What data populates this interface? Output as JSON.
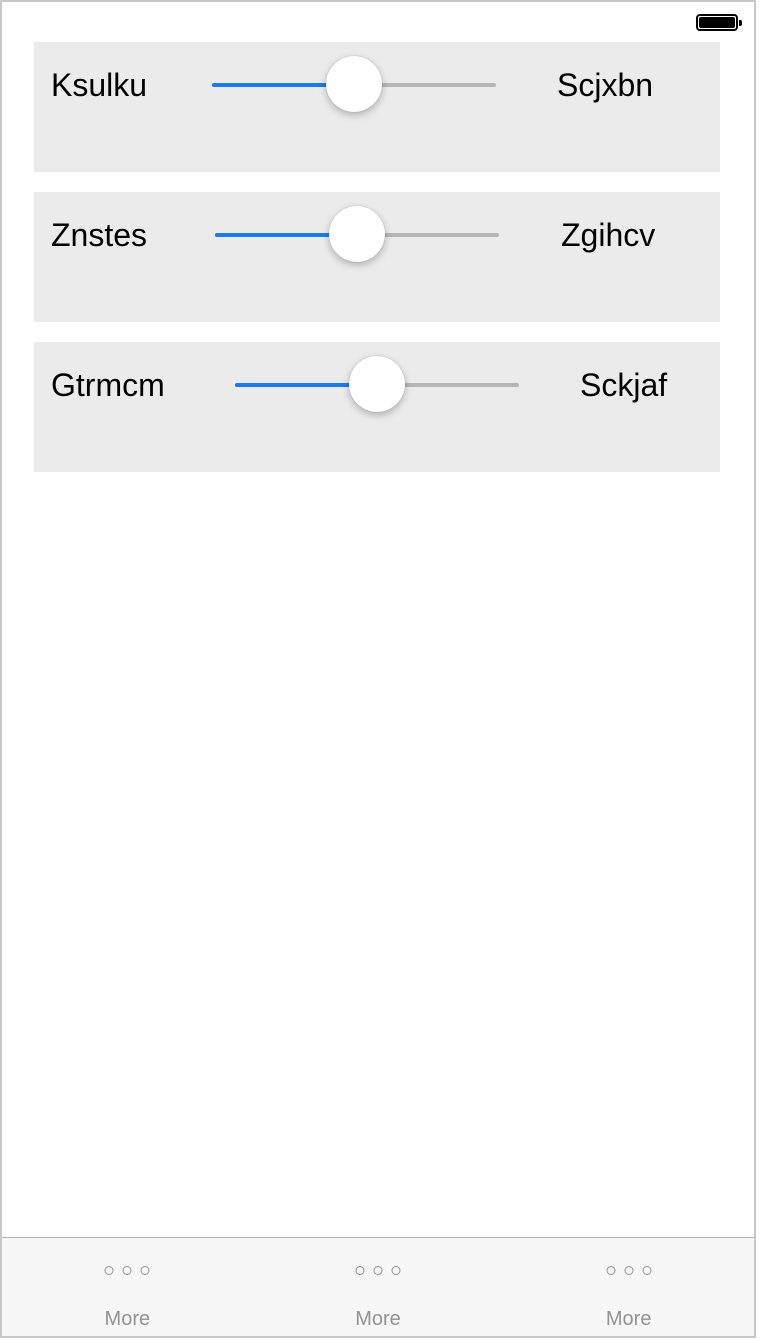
{
  "status_bar": {
    "battery_level": 1.0,
    "battery_icon": "battery-full-icon"
  },
  "rows": [
    {
      "left_label": "Ksulku",
      "right_label": "Scjxbn",
      "slider_value": 0.5
    },
    {
      "left_label": "Znstes",
      "right_label": "Zgihcv",
      "slider_value": 0.5
    },
    {
      "left_label": "Gtrmcm",
      "right_label": "Sckjaf",
      "slider_value": 0.5
    }
  ],
  "tab_bar": {
    "tabs": [
      {
        "label": "More",
        "icon": "more-dots-icon"
      },
      {
        "label": "More",
        "icon": "more-dots-icon"
      },
      {
        "label": "More",
        "icon": "more-dots-icon"
      }
    ]
  },
  "colors": {
    "accent": "#1a7bea",
    "track": "#b6b6b6",
    "row_background": "#ebebeb",
    "tab_label": "#929292"
  }
}
